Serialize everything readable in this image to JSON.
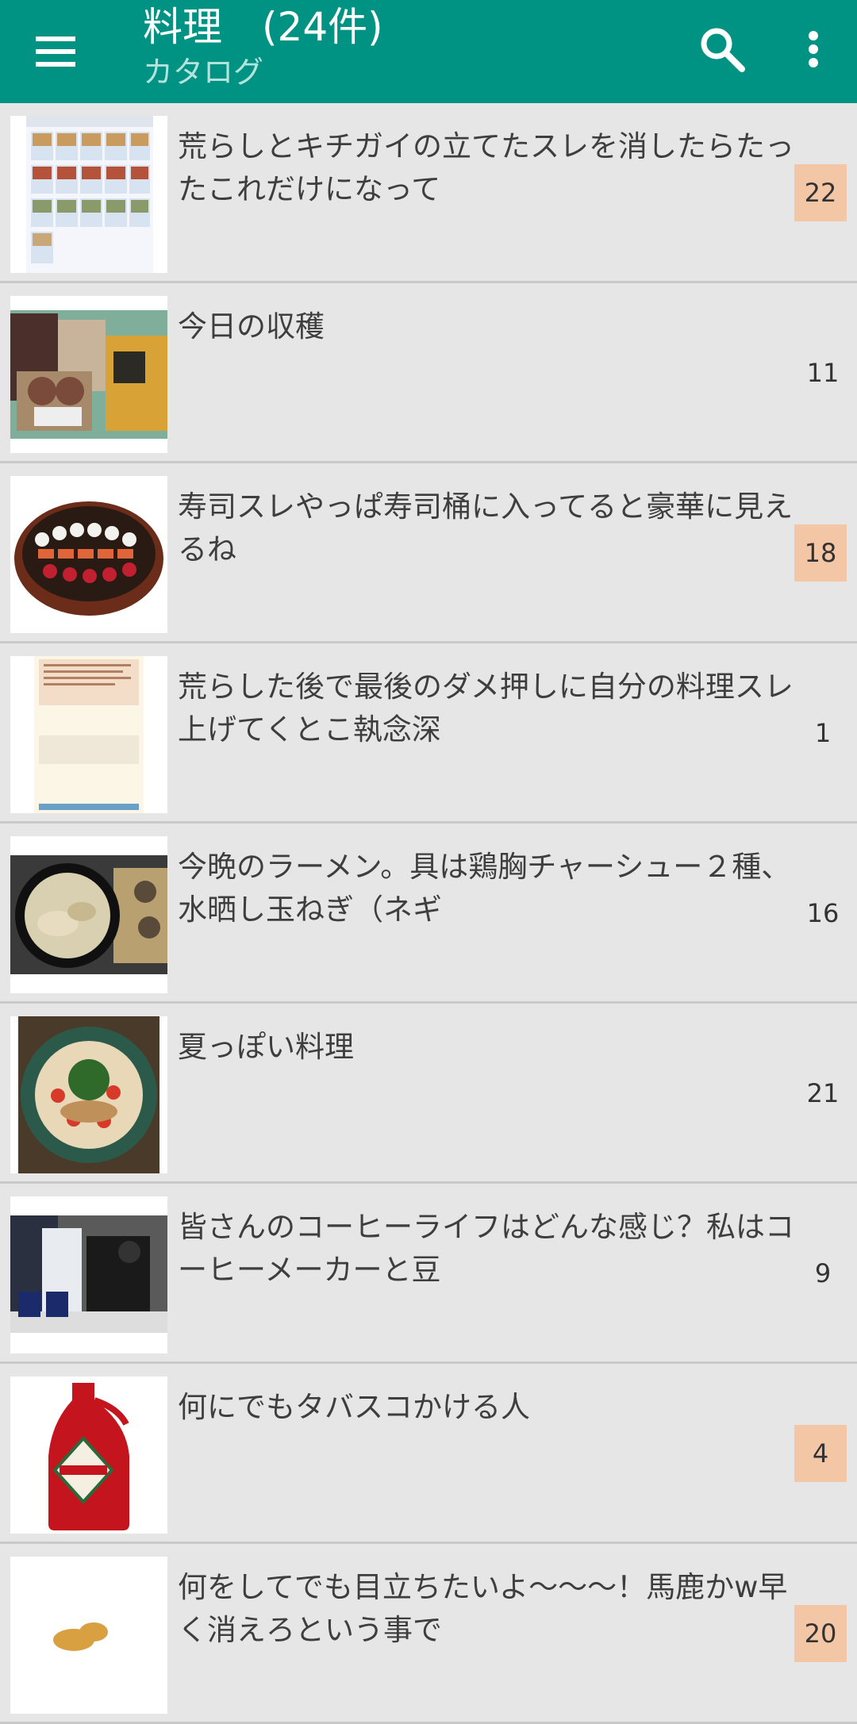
{
  "appbar": {
    "title": "料理　(24件)",
    "subtitle": "カタログ",
    "icons": {
      "menu": "hamburger-icon",
      "search": "search-icon",
      "more": "more-vert-icon"
    },
    "color": "#009384"
  },
  "threads": [
    {
      "title": "荒らしとキチガイの立てたスレを消したらたったこれだけになって",
      "count": "22",
      "highlight": true,
      "thumb": "screenshot-thumbnail"
    },
    {
      "title": "今日の収穫",
      "count": "11",
      "highlight": false,
      "thumb": "groceries-photo"
    },
    {
      "title": "寿司スレやっぱ寿司桶に入ってると豪華に見えるね",
      "count": "18",
      "highlight": true,
      "thumb": "sushi-platter-photo"
    },
    {
      "title": "荒らした後で最後のダメ押しに自分の料理スレ上げてくとこ執念深",
      "count": "1",
      "highlight": false,
      "thumb": "screenshot-thumbnail"
    },
    {
      "title": "今晩のラーメン。具は鶏胸チャーシュー２種、水晒し玉ねぎ（ネギ",
      "count": "16",
      "highlight": false,
      "thumb": "ramen-photo"
    },
    {
      "title": "夏っぽい料理",
      "count": "21",
      "highlight": false,
      "thumb": "salad-bowl-photo"
    },
    {
      "title": "皆さんのコーヒーライフはどんな感じ？私はコーヒーメーカーと豆",
      "count": "9",
      "highlight": false,
      "thumb": "coffee-maker-photo"
    },
    {
      "title": "何にでもタバスコかける人",
      "count": "4",
      "highlight": true,
      "thumb": "tabasco-bottle-photo"
    },
    {
      "title": "何をしてでも目立ちたいよ〜〜〜！馬鹿かw早く消えろという事で",
      "count": "20",
      "highlight": true,
      "thumb": "ginger-photo"
    }
  ],
  "colors": {
    "highlight": "#f3c6a6",
    "background": "#e6e6e6",
    "divider": "#c9c9c9"
  }
}
